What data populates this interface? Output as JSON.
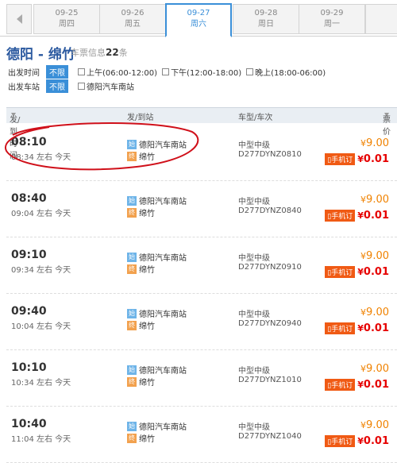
{
  "date_tabs": [
    {
      "date": "09-25",
      "weekday": "周四"
    },
    {
      "date": "09-26",
      "weekday": "周五"
    },
    {
      "date": "09-27",
      "weekday": "周六",
      "active": true
    },
    {
      "date": "09-28",
      "weekday": "周日"
    },
    {
      "date": "09-29",
      "weekday": "周一"
    }
  ],
  "route": {
    "title": "德阳 - 绵竹",
    "info_prefix": "车票信息",
    "count": "22",
    "info_suffix": "条"
  },
  "filters": {
    "time_label": "出发时间",
    "station_label": "出发车站",
    "unlimited": "不限",
    "time_options": [
      "上午(06:00-12:00)",
      "下午(12:00-18:00)",
      "晚上(18:00-06:00)"
    ],
    "station_options": [
      "德阳汽车南站"
    ]
  },
  "table_header": {
    "time": "发/到时间",
    "station": "发/到站",
    "bus": "车型/车次",
    "price": "票价"
  },
  "labels": {
    "start_tag": "始",
    "end_tag": "终",
    "mobile": "手机订",
    "yen": "¥"
  },
  "rows": [
    {
      "dep": "08:10",
      "arr": "08:34 左右 今天",
      "from": "德阳汽车南站",
      "to": "绵竹",
      "type": "中型中级",
      "code": "D277DYNZ0810",
      "price": "9.00",
      "mobile_price": "0.01"
    },
    {
      "dep": "08:40",
      "arr": "09:04 左右 今天",
      "from": "德阳汽车南站",
      "to": "绵竹",
      "type": "中型中级",
      "code": "D277DYNZ0840",
      "price": "9.00",
      "mobile_price": "0.01"
    },
    {
      "dep": "09:10",
      "arr": "09:34 左右 今天",
      "from": "德阳汽车南站",
      "to": "绵竹",
      "type": "中型中级",
      "code": "D277DYNZ0910",
      "price": "9.00",
      "mobile_price": "0.01"
    },
    {
      "dep": "09:40",
      "arr": "10:04 左右 今天",
      "from": "德阳汽车南站",
      "to": "绵竹",
      "type": "中型中级",
      "code": "D277DYNZ0940",
      "price": "9.00",
      "mobile_price": "0.01"
    },
    {
      "dep": "10:10",
      "arr": "10:34 左右 今天",
      "from": "德阳汽车南站",
      "to": "绵竹",
      "type": "中型中级",
      "code": "D277DYNZ1010",
      "price": "9.00",
      "mobile_price": "0.01"
    },
    {
      "dep": "10:40",
      "arr": "11:04 左右 今天",
      "from": "德阳汽车南站",
      "to": "绵竹",
      "type": "中型中级",
      "code": "D277DYNZ1040",
      "price": "9.00",
      "mobile_price": "0.01"
    }
  ],
  "colors": {
    "accent": "#3a8fd8",
    "price": "#f08200",
    "mobile_price": "#e60000",
    "annotation": "#d0101a"
  }
}
